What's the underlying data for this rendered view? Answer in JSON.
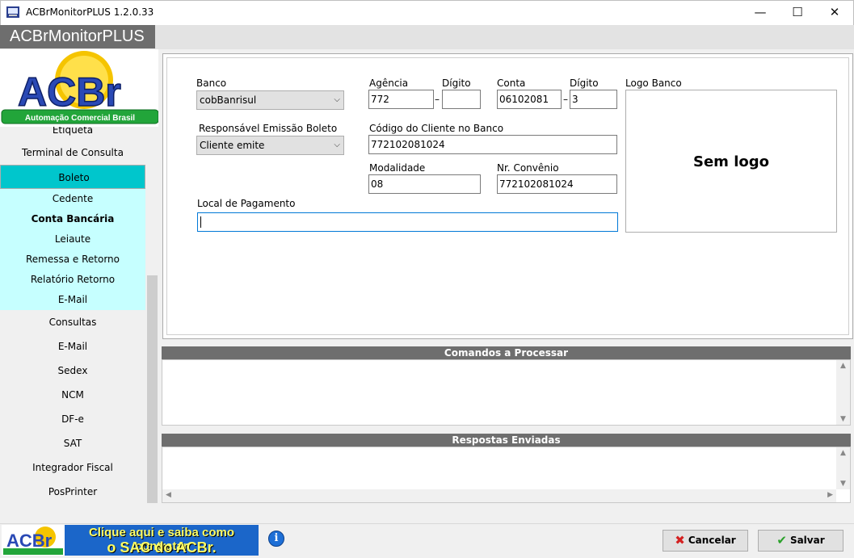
{
  "window": {
    "title": "ACBrMonitorPLUS 1.2.0.33",
    "minimize": "—",
    "maximize": "☐",
    "close": "✕"
  },
  "brand": {
    "label": "ACBrMonitorPLUS",
    "logo_text": "ACBr",
    "logo_tagline": "Automação Comercial Brasil"
  },
  "sidebar": {
    "items": [
      {
        "label": "Etiqueta"
      },
      {
        "label": "Terminal de Consulta"
      },
      {
        "label": "Boleto"
      },
      {
        "label": "Cedente"
      },
      {
        "label": "Conta Bancária"
      },
      {
        "label": "Leiaute"
      },
      {
        "label": "Remessa e Retorno"
      },
      {
        "label": "Relatório Retorno"
      },
      {
        "label": "E-Mail"
      },
      {
        "label": "Consultas"
      },
      {
        "label": "E-Mail"
      },
      {
        "label": "Sedex"
      },
      {
        "label": "NCM"
      },
      {
        "label": "DF-e"
      },
      {
        "label": "SAT"
      },
      {
        "label": "Integrador Fiscal"
      },
      {
        "label": "PosPrinter"
      }
    ]
  },
  "form": {
    "banco_label": "Banco",
    "banco_value": "cobBanrisul",
    "agencia_label": "Agência",
    "agencia_value": "772",
    "agencia_digito_label": "Dígito",
    "agencia_digito_value": "",
    "conta_label": "Conta",
    "conta_value": "06102081",
    "conta_digito_label": "Dígito",
    "conta_digito_value": "3",
    "logo_banco_label": "Logo Banco",
    "sem_logo": "Sem logo",
    "responsavel_label": "Responsável Emissão Boleto",
    "responsavel_value": "Cliente emite",
    "codigo_cliente_label": "Código do Cliente no Banco",
    "codigo_cliente_value": "772102081024",
    "modalidade_label": "Modalidade",
    "modalidade_value": "08",
    "convenio_label": "Nr. Convênio",
    "convenio_value": "772102081024",
    "local_pagamento_label": "Local de Pagamento",
    "local_pagamento_value": "",
    "separator": "–"
  },
  "panels": {
    "comandos": "Comandos a Processar",
    "respostas": "Respostas Enviadas"
  },
  "footer": {
    "sac_line1": "Clique aqui e saiba como contratar",
    "sac_line2": "o SAC do ACBr.",
    "info": "i",
    "cancel_label": "Cancelar",
    "save_label": "Salvar"
  },
  "colors": {
    "selected": "#00c6cc",
    "submenu": "#c6ffff",
    "header": "#6e6e6e"
  }
}
